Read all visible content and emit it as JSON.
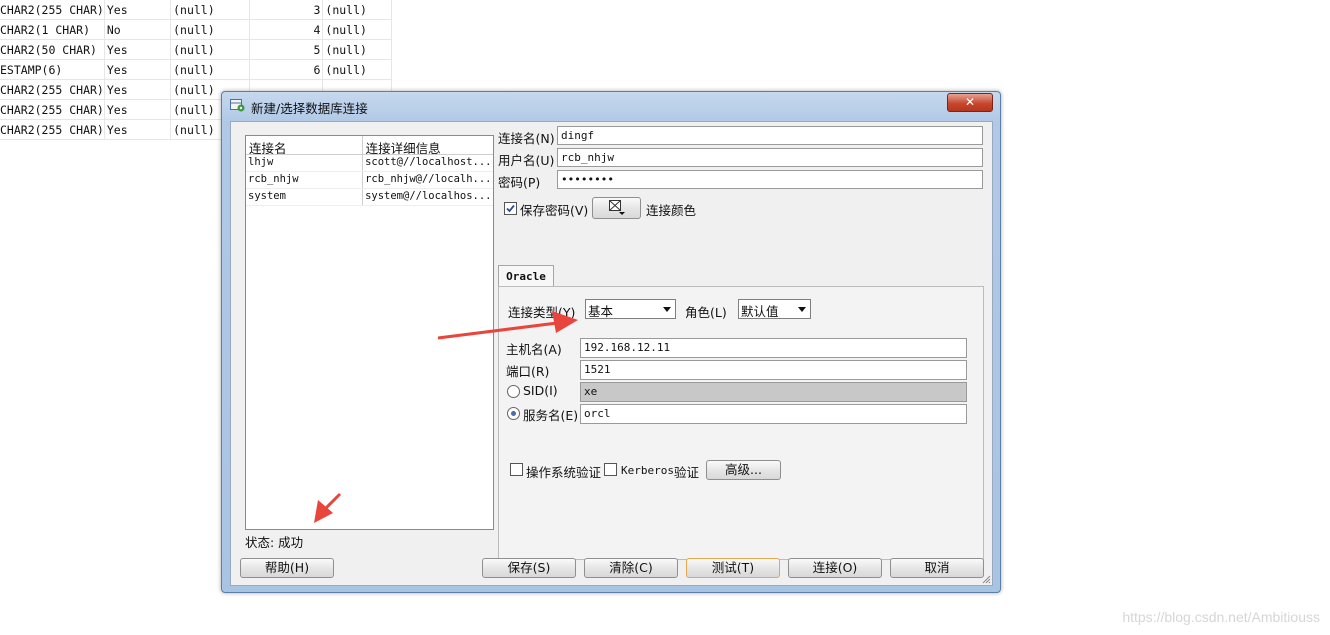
{
  "background_table": {
    "rows": [
      [
        "CHAR2(255 CHAR)",
        "Yes",
        "(null)",
        "3",
        "(null)"
      ],
      [
        "CHAR2(1 CHAR)",
        "No",
        "(null)",
        "4",
        "(null)"
      ],
      [
        "CHAR2(50 CHAR)",
        "Yes",
        "(null)",
        "5",
        "(null)"
      ],
      [
        "ESTAMP(6)",
        "Yes",
        "(null)",
        "6",
        "(null)"
      ],
      [
        "CHAR2(255 CHAR)",
        "Yes",
        "(null)",
        "",
        ""
      ],
      [
        "CHAR2(255 CHAR)",
        "Yes",
        "(null)",
        "",
        ""
      ],
      [
        "CHAR2(255 CHAR)",
        "Yes",
        "(null)",
        "",
        ""
      ]
    ]
  },
  "dialog": {
    "title": "新建/选择数据库连接",
    "close_icon": "close-x-icon",
    "connections": {
      "headers": [
        "连接名",
        "连接详细信息"
      ],
      "rows": [
        [
          "lhjw",
          "scott@//localhost..."
        ],
        [
          "rcb_nhjw",
          "rcb_nhjw@//localh..."
        ],
        [
          "system",
          "system@//localhos..."
        ]
      ]
    },
    "status": "状态: 成功",
    "form": {
      "conn_name_label": "连接名(N)",
      "conn_name_value": "dingf",
      "username_label": "用户名(U)",
      "username_value": "rcb_nhjw",
      "password_label": "密码(P)",
      "password_value": "••••••••",
      "save_password_label": "保存密码(V)",
      "save_password_checked": true,
      "conn_color_label": "连接颜色",
      "tab_label": "Oracle",
      "conn_type_label": "连接类型(Y)",
      "conn_type_value": "基本",
      "role_label": "角色(L)",
      "role_value": "默认值",
      "host_label": "主机名(A)",
      "host_value": "192.168.12.11",
      "port_label": "端口(R)",
      "port_value": "1521",
      "sid_label": "SID(I)",
      "sid_value": "xe",
      "service_label": "服务名(E)",
      "service_value": "orcl",
      "os_auth_label": "操作系统验证",
      "kerberos_label": "Kerberos",
      "kerberos_suffix": "验证",
      "advanced_label": "高级..."
    },
    "buttons": {
      "help": "帮助(H)",
      "save": "保存(S)",
      "clear": "清除(C)",
      "test": "测试(T)",
      "connect": "连接(O)",
      "cancel": "取消"
    }
  },
  "watermark": "https://blog.csdn.net/Ambitiouss",
  "colors": {
    "annotation_arrow": "#e8453c",
    "title_bar": "#b1c9e6",
    "close_button": "#c7472f"
  }
}
